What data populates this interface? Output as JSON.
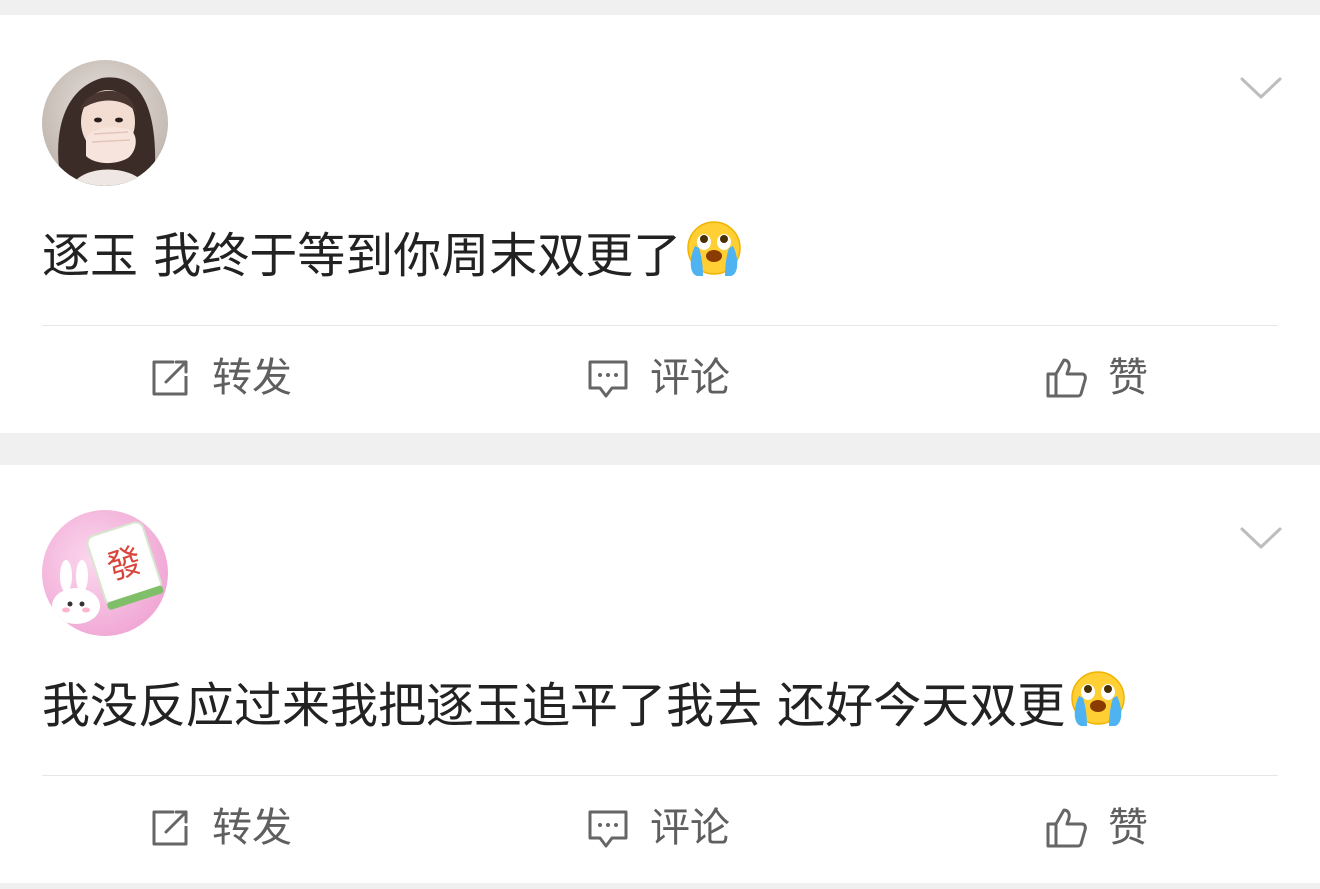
{
  "posts": [
    {
      "text": "逐玉 我终于等到你周末双更了",
      "emoji": "crying-emoji",
      "avatar": "girl-selfie-avatar"
    },
    {
      "text": "我没反应过来我把逐玉追平了我去 还好今天双更",
      "emoji": "crying-emoji",
      "avatar": "mahjong-fa-bunny-avatar"
    }
  ],
  "actions": {
    "repost": "转发",
    "comment": "评论",
    "like": "赞"
  },
  "icons": {
    "repost": "repost-icon",
    "comment": "comment-icon",
    "like": "thumbs-up-icon",
    "more": "chevron-down-icon"
  },
  "colors": {
    "page_bg": "#f0f0f0",
    "card_bg": "#ffffff",
    "text": "#222222",
    "action_text": "#5f5f5f",
    "divider": "#e6e6e6"
  }
}
